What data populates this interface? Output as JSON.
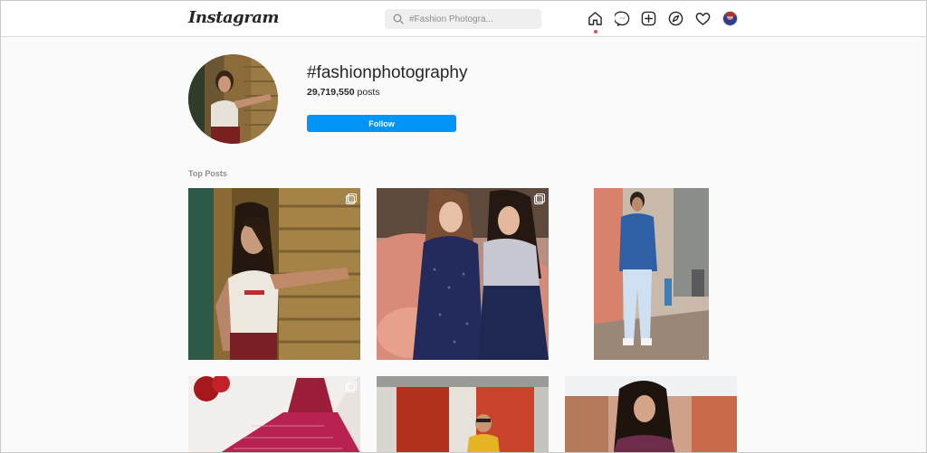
{
  "nav": {
    "logo": "Instagram",
    "search": {
      "value": "",
      "placeholder": "#Fashion Photogra..."
    },
    "icons": [
      "home-icon",
      "messenger-icon",
      "new-post-icon",
      "explore-icon",
      "activity-icon",
      "profile-avatar"
    ]
  },
  "header": {
    "hashtag": "#fashionphotography",
    "post_count": "29,719,550",
    "posts_label": "posts",
    "follow_label": "Follow"
  },
  "top_posts": {
    "title": "Top Posts",
    "posts": [
      {
        "description": "Woman in white tank top posing against wooden wall",
        "multiple": true
      },
      {
        "description": "Two women in sequin dresses seated on pink sofa",
        "multiple": true
      },
      {
        "description": "Man in blue sweater and white jeans standing on street",
        "multiple": false
      },
      {
        "description": "Fashion illustration of pink lehenga dress",
        "multiple": true
      },
      {
        "description": "Man in yellow jacket in front of red doors",
        "multiple": false
      },
      {
        "description": "Woman with long hair in traditional outfit",
        "multiple": false
      }
    ]
  },
  "colors": {
    "accent": "#0095f6",
    "notification": "#ed4956",
    "text": "#262626",
    "secondary": "#8e8e8e"
  }
}
